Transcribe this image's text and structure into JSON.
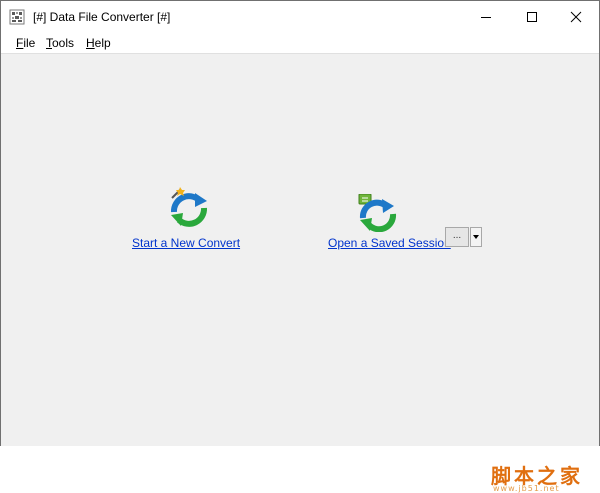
{
  "window": {
    "title": "[#] Data File Converter [#]",
    "icon": "app-grid-icon",
    "controls": [
      "minimize-icon",
      "maximize-icon",
      "close-icon"
    ]
  },
  "menu": {
    "file": {
      "mnemonic": "F",
      "rest": "ile"
    },
    "tools": {
      "mnemonic": "T",
      "rest": "ools"
    },
    "help": {
      "mnemonic": "H",
      "rest": "elp"
    }
  },
  "actions": {
    "new_convert": {
      "label": "Start a New Convert",
      "icon": "new-convert-icon"
    },
    "open_session": {
      "label": "Open a Saved Session",
      "icon": "open-session-icon",
      "browse_label": "...",
      "dropdown_icon": "dropdown-arrow-icon"
    }
  },
  "watermark": {
    "text": "脚本之家",
    "url": "www.jb51.net"
  },
  "colors": {
    "link": "#0033cc",
    "arrow_blue": "#1e78c8",
    "arrow_green": "#2aa83c",
    "watermark": "#e06f10"
  }
}
